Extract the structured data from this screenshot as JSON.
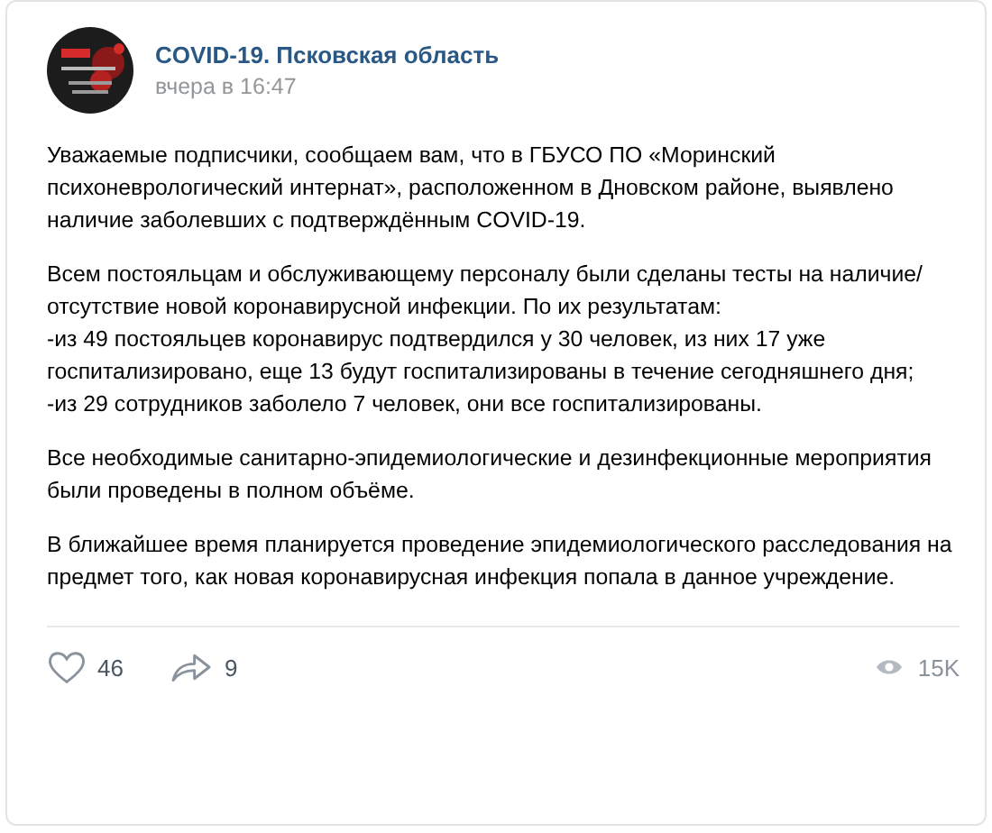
{
  "post": {
    "author": "COVID-19. Псковская область",
    "time": "вчера в 16:47",
    "paragraphs": [
      "Уважаемые подписчики, сообщаем вам, что в ГБУСО ПО «Моринский психоневрологический интернат», расположенном в Дновском районе, выявлено наличие заболевших с подтверждённым COVID-19.",
      "Всем постояльцам и обслуживающему персоналу были сделаны тесты на наличие/отсутствие новой коронавирусной инфекции. По их результатам:\n-из 49 постояльцев коронавирус подтвердился у 30 человек, из них 17 уже госпитализировано, еще 13 будут госпитализированы в течение сегодняшнего дня;\n-из 29 сотрудников заболело 7 человек, они все госпитализированы.",
      "Все необходимые санитарно-эпидемиологические и дезинфекционные мероприятия были проведены в полном объёме.",
      "В ближайшее время планируется проведение эпидемиологического расследования на предмет того, как новая коронавирусная инфекция попала в данное учреждение."
    ],
    "likes": "46",
    "shares": "9",
    "views": "15K"
  }
}
